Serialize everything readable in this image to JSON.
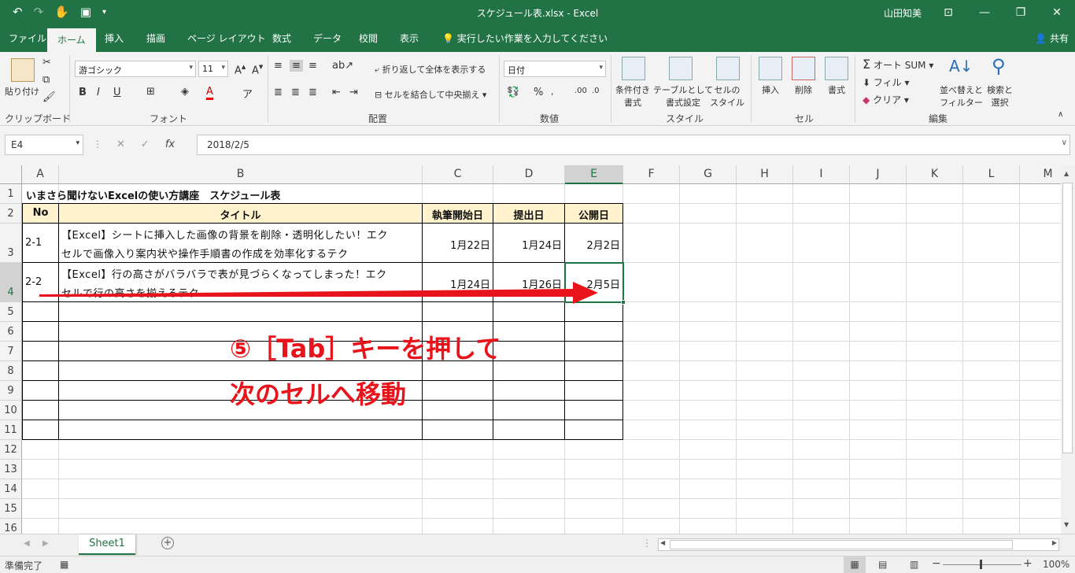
{
  "window": {
    "title": "スケジュール表.xlsx - Excel",
    "user": "山田知美"
  },
  "tabs": [
    "ファイル",
    "ホーム",
    "挿入",
    "描画",
    "ページ レイアウト",
    "数式",
    "データ",
    "校閲",
    "表示"
  ],
  "tell_me": "実行したい作業を入力してください",
  "share": "共有",
  "ribbon": {
    "clipboard": {
      "paste": "貼り付け",
      "label": "クリップボード"
    },
    "font": {
      "name": "游ゴシック",
      "size": "11",
      "label": "フォント",
      "bold": "B",
      "italic": "I",
      "underline": "U"
    },
    "align": {
      "wrap": "折り返して全体を表示する",
      "merge": "セルを結合して中央揃え",
      "label": "配置"
    },
    "number": {
      "format": "日付",
      "label": "数値"
    },
    "styles": {
      "cond": "条件付き\n書式",
      "table": "テーブルとして\n書式設定",
      "cell": "セルの\nスタイル",
      "label": "スタイル"
    },
    "cells": {
      "insert": "挿入",
      "delete": "削除",
      "format": "書式",
      "label": "セル"
    },
    "editing": {
      "autosum": "オート SUM",
      "fill": "フィル",
      "clear": "クリア",
      "sort": "並べ替えと\nフィルター",
      "find": "検索と\n選択",
      "label": "編集"
    }
  },
  "formula_bar": {
    "name_box": "E4",
    "value": "2018/2/5"
  },
  "columns": [
    "A",
    "B",
    "C",
    "D",
    "E",
    "F",
    "G",
    "H",
    "I",
    "J",
    "K",
    "L",
    "M"
  ],
  "rows": [
    "1",
    "2",
    "3",
    "4",
    "5",
    "6",
    "7",
    "8",
    "9",
    "10",
    "11",
    "12",
    "13",
    "14",
    "15",
    "16"
  ],
  "sheet": {
    "title": "いまさら聞けないExcelの使い方講座　スケジュール表",
    "headers": {
      "no": "No",
      "title": "タイトル",
      "start": "執筆開始日",
      "submit": "提出日",
      "publish": "公開日"
    },
    "rows": [
      {
        "no": "2-1",
        "title1": "【Excel】シートに挿入した画像の背景を削除・透明化したい！エク",
        "title2": "セルで画像入り案内状や操作手順書の作成を効率化するテク",
        "start": "1月22日",
        "submit": "1月24日",
        "publish": "2月2日"
      },
      {
        "no": "2-2",
        "title1": "【Excel】行の高さがバラバラで表が見づらくなってしまった！エク",
        "title2": "セルで行の高さを揃えるテク",
        "start": "1月24日",
        "submit": "1月26日",
        "publish": "2月5日"
      }
    ]
  },
  "annotation": {
    "line1": "⑤［Tab］キーを押して",
    "line2": "次のセルへ移動"
  },
  "sheet_tab": "Sheet1",
  "status": {
    "ready": "準備完了",
    "zoom": "100%"
  }
}
